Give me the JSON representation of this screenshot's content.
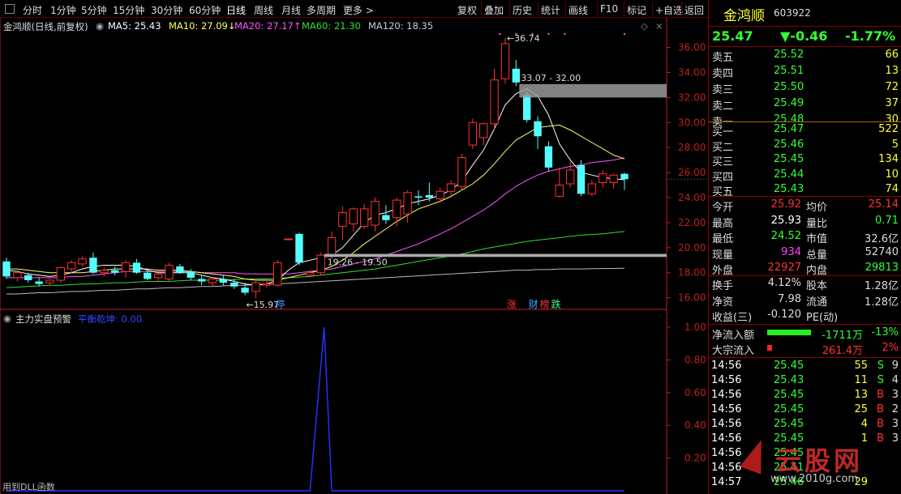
{
  "toolbar": {
    "periods": [
      "分时",
      "1分钟",
      "5分钟",
      "15分钟",
      "30分钟",
      "60分钟",
      "日线",
      "周线",
      "月线",
      "多周期",
      "更多 >"
    ],
    "active": "日线",
    "actions": [
      "复权",
      "叠加",
      "历史",
      "统计",
      "画线",
      "F10",
      "标记",
      "+自选",
      "返回"
    ]
  },
  "stock": {
    "name": "金鸿顺",
    "code": "603922",
    "price": "25.47",
    "change": "▼-0.46",
    "pct": "-1.77%"
  },
  "ma_header": {
    "title": "金鸿顺(日线,前复权)",
    "ma5": "MA5: 25.43",
    "ma10": "MA10: 27.09↓",
    "ma20": "MA20: 27.17↑",
    "ma60": "MA60: 21.30",
    "ma120": "MA120: 18.35"
  },
  "colors": {
    "up": "#ff3232",
    "down": "#54ffff",
    "ma5": "#ffffff",
    "ma10": "#ffff66",
    "ma20": "#ff55ff",
    "ma60": "#33dd33",
    "ma120": "#bbbbbb",
    "axis": "#c02020"
  },
  "chart_data": [
    {
      "type": "candlestick",
      "y_axis": [
        "36.00",
        "34.00",
        "32.00",
        "30.00",
        "28.00",
        "26.00",
        "24.00",
        "22.00",
        "20.00",
        "18.00",
        "16.00"
      ],
      "ylim": [
        15.2,
        37.2
      ],
      "annotations": {
        "high": "36.74",
        "low": "15.97",
        "band_upper": "33.07 - 32.00",
        "band_lower": "19.26 - 19.50"
      },
      "candles": [
        {
          "o": 18.9,
          "h": 19.2,
          "l": 17.5,
          "c": 17.7
        },
        {
          "o": 17.6,
          "h": 18.2,
          "l": 17.3,
          "c": 18.0
        },
        {
          "o": 17.8,
          "h": 18.0,
          "l": 17.2,
          "c": 17.4
        },
        {
          "o": 17.3,
          "h": 17.6,
          "l": 16.9,
          "c": 17.1
        },
        {
          "o": 17.2,
          "h": 17.5,
          "l": 17.0,
          "c": 17.4
        },
        {
          "o": 17.4,
          "h": 18.5,
          "l": 17.2,
          "c": 18.4
        },
        {
          "o": 18.3,
          "h": 19.0,
          "l": 18.0,
          "c": 18.8
        },
        {
          "o": 18.7,
          "h": 19.3,
          "l": 18.5,
          "c": 19.1
        },
        {
          "o": 19.2,
          "h": 19.6,
          "l": 17.9,
          "c": 18.0
        },
        {
          "o": 18.0,
          "h": 18.4,
          "l": 17.7,
          "c": 18.2
        },
        {
          "o": 18.2,
          "h": 18.5,
          "l": 17.8,
          "c": 18.0
        },
        {
          "o": 18.1,
          "h": 19.0,
          "l": 17.6,
          "c": 18.8
        },
        {
          "o": 18.8,
          "h": 19.1,
          "l": 17.9,
          "c": 18.0
        },
        {
          "o": 18.0,
          "h": 18.3,
          "l": 17.4,
          "c": 17.5
        },
        {
          "o": 17.6,
          "h": 18.0,
          "l": 17.3,
          "c": 17.9
        },
        {
          "o": 17.5,
          "h": 18.8,
          "l": 17.3,
          "c": 18.6
        },
        {
          "o": 18.5,
          "h": 18.7,
          "l": 17.9,
          "c": 18.0
        },
        {
          "o": 18.1,
          "h": 18.3,
          "l": 17.4,
          "c": 17.6
        },
        {
          "o": 17.5,
          "h": 17.8,
          "l": 17.0,
          "c": 17.3
        },
        {
          "o": 17.2,
          "h": 17.6,
          "l": 16.9,
          "c": 17.5
        },
        {
          "o": 17.5,
          "h": 17.8,
          "l": 17.0,
          "c": 17.2
        },
        {
          "o": 17.2,
          "h": 17.5,
          "l": 16.7,
          "c": 16.9
        },
        {
          "o": 16.8,
          "h": 17.2,
          "l": 16.2,
          "c": 16.4
        },
        {
          "o": 16.5,
          "h": 17.4,
          "l": 15.97,
          "c": 17.2
        },
        {
          "o": 17.0,
          "h": 17.6,
          "l": 16.8,
          "c": 17.1
        },
        {
          "o": 17.0,
          "h": 19.0,
          "l": 16.9,
          "c": 18.8
        },
        {
          "o": 20.7,
          "h": 20.7,
          "l": 20.6,
          "c": 20.7
        },
        {
          "o": 21.1,
          "h": 21.2,
          "l": 18.6,
          "c": 18.8
        },
        {
          "o": 17.8,
          "h": 18.2,
          "l": 17.6,
          "c": 18.0
        },
        {
          "o": 18.0,
          "h": 19.6,
          "l": 17.8,
          "c": 19.4
        },
        {
          "o": 19.3,
          "h": 21.3,
          "l": 19.1,
          "c": 20.8
        },
        {
          "o": 21.7,
          "h": 23.3,
          "l": 20.6,
          "c": 22.8
        },
        {
          "o": 21.9,
          "h": 23.2,
          "l": 21.3,
          "c": 23.1
        },
        {
          "o": 21.7,
          "h": 23.5,
          "l": 21.5,
          "c": 23.1
        },
        {
          "o": 21.8,
          "h": 24.0,
          "l": 21.3,
          "c": 23.7
        },
        {
          "o": 22.6,
          "h": 23.4,
          "l": 21.9,
          "c": 22.2
        },
        {
          "o": 22.4,
          "h": 24.0,
          "l": 21.7,
          "c": 23.8
        },
        {
          "o": 22.7,
          "h": 24.6,
          "l": 22.0,
          "c": 24.4
        },
        {
          "o": 24.1,
          "h": 24.6,
          "l": 23.4,
          "c": 24.0
        },
        {
          "o": 24.2,
          "h": 25.2,
          "l": 23.7,
          "c": 24.0
        },
        {
          "o": 23.9,
          "h": 24.8,
          "l": 23.6,
          "c": 24.5
        },
        {
          "o": 24.5,
          "h": 25.4,
          "l": 24.0,
          "c": 25.1
        },
        {
          "o": 24.9,
          "h": 27.5,
          "l": 24.6,
          "c": 27.2
        },
        {
          "o": 28.2,
          "h": 30.3,
          "l": 27.9,
          "c": 30.0
        },
        {
          "o": 28.8,
          "h": 30.0,
          "l": 28.2,
          "c": 29.9
        },
        {
          "o": 29.9,
          "h": 34.3,
          "l": 29.4,
          "c": 33.4
        },
        {
          "o": 33.5,
          "h": 36.74,
          "l": 33.1,
          "c": 36.3
        },
        {
          "o": 34.3,
          "h": 35.0,
          "l": 32.9,
          "c": 33.2
        },
        {
          "o": 32.2,
          "h": 32.5,
          "l": 30.0,
          "c": 30.2
        },
        {
          "o": 30.1,
          "h": 30.5,
          "l": 27.9,
          "c": 28.9
        },
        {
          "o": 28.1,
          "h": 28.5,
          "l": 26.1,
          "c": 26.4
        },
        {
          "o": 24.1,
          "h": 26.4,
          "l": 24.0,
          "c": 25.0
        },
        {
          "o": 25.1,
          "h": 26.9,
          "l": 24.8,
          "c": 26.2
        },
        {
          "o": 26.6,
          "h": 27.0,
          "l": 24.1,
          "c": 24.3
        },
        {
          "o": 24.3,
          "h": 25.4,
          "l": 24.1,
          "c": 25.1
        },
        {
          "o": 25.2,
          "h": 26.2,
          "l": 24.8,
          "c": 25.9
        },
        {
          "o": 25.2,
          "h": 25.9,
          "l": 24.7,
          "c": 25.8
        },
        {
          "o": 25.9,
          "h": 26.0,
          "l": 24.6,
          "c": 25.47
        }
      ],
      "ma5": [
        18.2,
        18.1,
        17.9,
        17.8,
        17.7,
        17.8,
        18.0,
        18.3,
        18.5,
        18.6,
        18.6,
        18.6,
        18.5,
        18.2,
        18.0,
        18.0,
        18.0,
        18.0,
        17.8,
        17.6,
        17.5,
        17.3,
        17.1,
        17.0,
        17.1,
        17.4,
        18.2,
        18.8,
        19.0,
        19.2,
        19.4,
        20.0,
        21.0,
        22.0,
        22.6,
        22.8,
        23.1,
        23.5,
        23.7,
        23.9,
        24.2,
        24.6,
        25.3,
        26.6,
        27.8,
        29.5,
        31.4,
        32.3,
        32.7,
        32.1,
        30.6,
        28.3,
        27.0,
        26.0,
        25.8,
        25.6,
        25.5,
        25.43
      ],
      "ma10": [
        18.3,
        18.3,
        18.2,
        18.1,
        18.0,
        18.0,
        18.0,
        18.0,
        18.1,
        18.2,
        18.3,
        18.3,
        18.3,
        18.3,
        18.2,
        18.2,
        18.2,
        18.1,
        18.0,
        17.9,
        17.8,
        17.7,
        17.5,
        17.4,
        17.4,
        17.4,
        17.6,
        17.8,
        18.0,
        18.2,
        18.5,
        19.0,
        19.6,
        20.3,
        20.9,
        21.5,
        22.1,
        22.6,
        23.1,
        23.4,
        23.7,
        24.1,
        24.6,
        25.1,
        25.8,
        26.7,
        27.7,
        28.6,
        29.1,
        29.6,
        29.7,
        29.8,
        29.4,
        28.9,
        28.4,
        27.9,
        27.4,
        27.09
      ],
      "ma20": [
        17.6,
        17.6,
        17.6,
        17.6,
        17.6,
        17.6,
        17.7,
        17.7,
        17.8,
        17.9,
        18.0,
        18.1,
        18.1,
        18.1,
        18.1,
        18.1,
        18.1,
        18.1,
        18.0,
        18.0,
        18.0,
        18.0,
        17.9,
        17.9,
        17.9,
        17.9,
        17.9,
        18.0,
        18.1,
        18.2,
        18.3,
        18.5,
        18.7,
        18.9,
        19.1,
        19.4,
        19.7,
        20.0,
        20.3,
        20.7,
        21.1,
        21.5,
        22.0,
        22.5,
        23.0,
        23.6,
        24.3,
        24.9,
        25.4,
        25.8,
        26.1,
        26.3,
        26.5,
        26.6,
        26.8,
        26.9,
        27.0,
        27.17
      ],
      "ma60": [
        16.8,
        16.85,
        16.9,
        16.95,
        17.0,
        17.0,
        17.05,
        17.1,
        17.1,
        17.15,
        17.2,
        17.2,
        17.25,
        17.3,
        17.3,
        17.3,
        17.35,
        17.4,
        17.4,
        17.4,
        17.4,
        17.45,
        17.5,
        17.5,
        17.5,
        17.55,
        17.6,
        17.65,
        17.7,
        17.8,
        17.9,
        18.0,
        18.1,
        18.2,
        18.3,
        18.45,
        18.6,
        18.75,
        18.9,
        19.05,
        19.2,
        19.35,
        19.5,
        19.7,
        19.9,
        20.05,
        20.2,
        20.35,
        20.5,
        20.6,
        20.7,
        20.8,
        20.9,
        21.0,
        21.05,
        21.1,
        21.2,
        21.3
      ],
      "ma120": [
        16.3,
        16.3,
        16.35,
        16.4,
        16.4,
        16.45,
        16.5,
        16.5,
        16.55,
        16.6,
        16.6,
        16.65,
        16.7,
        16.7,
        16.75,
        16.8,
        16.8,
        16.85,
        16.9,
        16.9,
        16.95,
        17.0,
        17.0,
        17.05,
        17.1,
        17.1,
        17.15,
        17.2,
        17.25,
        17.3,
        17.35,
        17.4,
        17.45,
        17.5,
        17.55,
        17.6,
        17.65,
        17.7,
        17.75,
        17.8,
        17.85,
        17.9,
        17.95,
        18.0,
        18.05,
        18.1,
        18.15,
        18.2,
        18.2,
        18.25,
        18.25,
        18.3,
        18.3,
        18.3,
        18.32,
        18.33,
        18.34,
        18.35
      ]
    },
    {
      "type": "line",
      "title": "主力实盘预警",
      "series_label": "平衡乾坤: 0.00",
      "y_axis": [
        "1.00",
        "0.80",
        "0.60",
        "0.40",
        "0.20"
      ],
      "ylim": [
        0,
        1.05
      ],
      "values": [
        0,
        0,
        0,
        0,
        0,
        0,
        0,
        0,
        0,
        0,
        0,
        0,
        0,
        0,
        0,
        0,
        0,
        0,
        0,
        0,
        0,
        0,
        0,
        0,
        0,
        0,
        0,
        0,
        0,
        1,
        0,
        0,
        0,
        0,
        0,
        0,
        0,
        0,
        0,
        0,
        0,
        0,
        0,
        0,
        0,
        0,
        0,
        0,
        0,
        0,
        0,
        0,
        0,
        0,
        0,
        0,
        0,
        0
      ]
    }
  ],
  "event_tags": [
    "停",
    "涨",
    "财",
    "榜",
    "跌"
  ],
  "indicator_header": {
    "title": "主力实盘预警",
    "value": "平衡乾坤: 0.00"
  },
  "footer_text": "用到DLL函数",
  "orderbook": {
    "sell": [
      {
        "label": "卖五",
        "price": "25.52",
        "vol": "66"
      },
      {
        "label": "卖四",
        "price": "25.51",
        "vol": "13"
      },
      {
        "label": "卖三",
        "price": "25.50",
        "vol": "72"
      },
      {
        "label": "卖二",
        "price": "25.49",
        "vol": "37"
      },
      {
        "label": "卖一",
        "price": "25.48",
        "vol": "30"
      }
    ],
    "buy": [
      {
        "label": "买一",
        "price": "25.47",
        "vol": "522"
      },
      {
        "label": "买二",
        "price": "25.46",
        "vol": "5"
      },
      {
        "label": "买三",
        "price": "25.45",
        "vol": "134"
      },
      {
        "label": "买四",
        "price": "25.44",
        "vol": "10"
      },
      {
        "label": "买五",
        "price": "25.43",
        "vol": "74"
      }
    ]
  },
  "stats": [
    {
      "l1": "今开",
      "v1": "25.92",
      "l2": "均价",
      "v2": "25.14"
    },
    {
      "l1": "最高",
      "v1": "25.93",
      "l2": "量比",
      "v2": "0.71"
    },
    {
      "l1": "最低",
      "v1": "24.52",
      "l2": "市值",
      "v2": "32.6亿"
    },
    {
      "l1": "现量",
      "v1": "934",
      "l2": "总量",
      "v2": "52740"
    },
    {
      "l1": "外盘",
      "v1": "22927",
      "l2": "内盘",
      "v2": "29813"
    }
  ],
  "stats2": [
    {
      "l1": "换手",
      "v1": "4.12%",
      "l2": "股本",
      "v2": "1.28亿"
    },
    {
      "l1": "净资",
      "v1": "7.98",
      "l2": "流通",
      "v2": "1.28亿"
    },
    {
      "l1": "收益(三)",
      "v1": "-0.120",
      "l2": "PE(动)",
      "v2": ""
    }
  ],
  "flow": [
    {
      "label": "净流入额",
      "value": "-1711万",
      "pct": "-13%"
    },
    {
      "label": "大宗流入",
      "value": "261.4万",
      "pct": "2%"
    }
  ],
  "ticks": [
    {
      "t": "14:56",
      "p": "25.45",
      "v": "55",
      "d": "S",
      "n": "9"
    },
    {
      "t": "14:56",
      "p": "25.43",
      "v": "11",
      "d": "S",
      "n": "4"
    },
    {
      "t": "14:56",
      "p": "25.45",
      "v": "13",
      "d": "B",
      "n": "3"
    },
    {
      "t": "14:56",
      "p": "25.45",
      "v": "25",
      "d": "B",
      "n": "2"
    },
    {
      "t": "14:56",
      "p": "25.45",
      "v": "4",
      "d": "B",
      "n": "3"
    },
    {
      "t": "14:56",
      "p": "25.45",
      "v": "1",
      "d": "B",
      "n": "3"
    },
    {
      "t": "14:56",
      "p": "25.45",
      "v": "",
      "d": "",
      "n": ""
    },
    {
      "t": "14:56",
      "p": "25.41",
      "v": "",
      "d": "",
      "n": ""
    },
    {
      "t": "14:57",
      "p": "25.46",
      "v": "29",
      "d": "",
      "n": ""
    }
  ],
  "watermark": {
    "brand": "云股网",
    "url": "www.2010g.com"
  }
}
